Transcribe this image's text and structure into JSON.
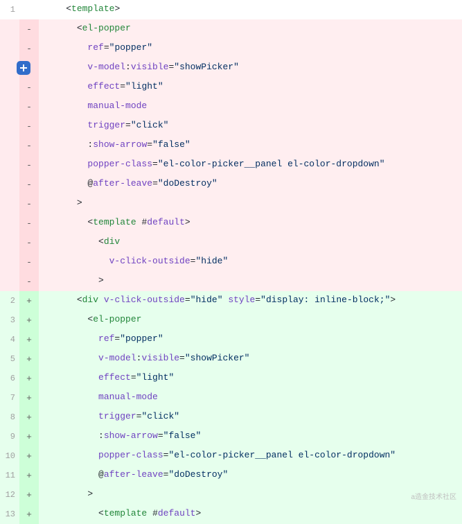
{
  "watermark": "a造金技术社区",
  "lines": [
    {
      "num": "1",
      "type": "context",
      "marker": "",
      "indent": 2,
      "tokens": [
        {
          "t": "punc",
          "v": "<"
        },
        {
          "t": "tag",
          "v": "template"
        },
        {
          "t": "punc",
          "v": ">"
        }
      ]
    },
    {
      "num": "",
      "type": "removed",
      "marker": "-",
      "indent": 3,
      "tokens": [
        {
          "t": "punc",
          "v": "<"
        },
        {
          "t": "tag",
          "v": "el-popper"
        }
      ]
    },
    {
      "num": "",
      "type": "removed",
      "marker": "-",
      "indent": 4,
      "tokens": [
        {
          "t": "attr",
          "v": "ref"
        },
        {
          "t": "punc",
          "v": "="
        },
        {
          "t": "str",
          "v": "\"popper\""
        }
      ]
    },
    {
      "num": "",
      "type": "removed",
      "marker": "-",
      "indent": 4,
      "tokens": [
        {
          "t": "attr",
          "v": "v-model"
        },
        {
          "t": "punc",
          "v": ":"
        },
        {
          "t": "attr",
          "v": "visible"
        },
        {
          "t": "punc",
          "v": "="
        },
        {
          "t": "str",
          "v": "\"showPicker\""
        }
      ]
    },
    {
      "num": "",
      "type": "removed",
      "marker": "-",
      "indent": 4,
      "tokens": [
        {
          "t": "attr",
          "v": "effect"
        },
        {
          "t": "punc",
          "v": "="
        },
        {
          "t": "str",
          "v": "\"light\""
        }
      ]
    },
    {
      "num": "",
      "type": "removed",
      "marker": "-",
      "indent": 4,
      "tokens": [
        {
          "t": "attr",
          "v": "manual-mode"
        }
      ]
    },
    {
      "num": "",
      "type": "removed",
      "marker": "-",
      "indent": 4,
      "tokens": [
        {
          "t": "attr",
          "v": "trigger"
        },
        {
          "t": "punc",
          "v": "="
        },
        {
          "t": "str",
          "v": "\"click\""
        }
      ]
    },
    {
      "num": "",
      "type": "removed",
      "marker": "-",
      "indent": 4,
      "tokens": [
        {
          "t": "punc",
          "v": ":"
        },
        {
          "t": "attr",
          "v": "show-arrow"
        },
        {
          "t": "punc",
          "v": "="
        },
        {
          "t": "str",
          "v": "\"false\""
        }
      ]
    },
    {
      "num": "",
      "type": "removed",
      "marker": "-",
      "indent": 4,
      "tokens": [
        {
          "t": "attr",
          "v": "popper-class"
        },
        {
          "t": "punc",
          "v": "="
        },
        {
          "t": "str",
          "v": "\"el-color-picker__panel el-color-dropdown\""
        }
      ]
    },
    {
      "num": "",
      "type": "removed",
      "marker": "-",
      "indent": 4,
      "tokens": [
        {
          "t": "punc",
          "v": "@"
        },
        {
          "t": "attr",
          "v": "after-leave"
        },
        {
          "t": "punc",
          "v": "="
        },
        {
          "t": "str",
          "v": "\"doDestroy\""
        }
      ]
    },
    {
      "num": "",
      "type": "removed",
      "marker": "-",
      "indent": 3,
      "tokens": [
        {
          "t": "punc",
          "v": ">"
        }
      ]
    },
    {
      "num": "",
      "type": "removed",
      "marker": "-",
      "indent": 4,
      "tokens": [
        {
          "t": "punc",
          "v": "<"
        },
        {
          "t": "tag",
          "v": "template"
        },
        {
          "t": "txt",
          "v": " "
        },
        {
          "t": "punc",
          "v": "#"
        },
        {
          "t": "attr",
          "v": "default"
        },
        {
          "t": "punc",
          "v": ">"
        }
      ]
    },
    {
      "num": "",
      "type": "removed",
      "marker": "-",
      "indent": 5,
      "tokens": [
        {
          "t": "punc",
          "v": "<"
        },
        {
          "t": "tag",
          "v": "div"
        }
      ]
    },
    {
      "num": "",
      "type": "removed",
      "marker": "-",
      "indent": 6,
      "tokens": [
        {
          "t": "attr",
          "v": "v-click-outside"
        },
        {
          "t": "punc",
          "v": "="
        },
        {
          "t": "str",
          "v": "\"hide\""
        }
      ]
    },
    {
      "num": "",
      "type": "removed",
      "marker": "-",
      "indent": 5,
      "tokens": [
        {
          "t": "punc",
          "v": ">"
        }
      ]
    },
    {
      "num": "2",
      "type": "added",
      "marker": "+",
      "indent": 3,
      "tokens": [
        {
          "t": "punc",
          "v": "<"
        },
        {
          "t": "tag",
          "v": "div"
        },
        {
          "t": "txt",
          "v": " "
        },
        {
          "t": "attr",
          "v": "v-click-outside"
        },
        {
          "t": "punc",
          "v": "="
        },
        {
          "t": "str",
          "v": "\"hide\""
        },
        {
          "t": "txt",
          "v": " "
        },
        {
          "t": "attr",
          "v": "style"
        },
        {
          "t": "punc",
          "v": "="
        },
        {
          "t": "str",
          "v": "\"display: inline-block;\""
        },
        {
          "t": "punc",
          "v": ">"
        }
      ]
    },
    {
      "num": "3",
      "type": "added",
      "marker": "+",
      "indent": 4,
      "tokens": [
        {
          "t": "punc",
          "v": "<"
        },
        {
          "t": "tag",
          "v": "el-popper"
        }
      ]
    },
    {
      "num": "4",
      "type": "added",
      "marker": "+",
      "indent": 5,
      "tokens": [
        {
          "t": "attr",
          "v": "ref"
        },
        {
          "t": "punc",
          "v": "="
        },
        {
          "t": "str",
          "v": "\"popper\""
        }
      ]
    },
    {
      "num": "5",
      "type": "added",
      "marker": "+",
      "indent": 5,
      "tokens": [
        {
          "t": "attr",
          "v": "v-model"
        },
        {
          "t": "punc",
          "v": ":"
        },
        {
          "t": "attr",
          "v": "visible"
        },
        {
          "t": "punc",
          "v": "="
        },
        {
          "t": "str",
          "v": "\"showPicker\""
        }
      ]
    },
    {
      "num": "6",
      "type": "added",
      "marker": "+",
      "indent": 5,
      "tokens": [
        {
          "t": "attr",
          "v": "effect"
        },
        {
          "t": "punc",
          "v": "="
        },
        {
          "t": "str",
          "v": "\"light\""
        }
      ]
    },
    {
      "num": "7",
      "type": "added",
      "marker": "+",
      "indent": 5,
      "tokens": [
        {
          "t": "attr",
          "v": "manual-mode"
        }
      ]
    },
    {
      "num": "8",
      "type": "added",
      "marker": "+",
      "indent": 5,
      "tokens": [
        {
          "t": "attr",
          "v": "trigger"
        },
        {
          "t": "punc",
          "v": "="
        },
        {
          "t": "str",
          "v": "\"click\""
        }
      ]
    },
    {
      "num": "9",
      "type": "added",
      "marker": "+",
      "indent": 5,
      "tokens": [
        {
          "t": "punc",
          "v": ":"
        },
        {
          "t": "attr",
          "v": "show-arrow"
        },
        {
          "t": "punc",
          "v": "="
        },
        {
          "t": "str",
          "v": "\"false\""
        }
      ]
    },
    {
      "num": "10",
      "type": "added",
      "marker": "+",
      "indent": 5,
      "tokens": [
        {
          "t": "attr",
          "v": "popper-class"
        },
        {
          "t": "punc",
          "v": "="
        },
        {
          "t": "str",
          "v": "\"el-color-picker__panel el-color-dropdown\""
        }
      ]
    },
    {
      "num": "11",
      "type": "added",
      "marker": "+",
      "indent": 5,
      "tokens": [
        {
          "t": "punc",
          "v": "@"
        },
        {
          "t": "attr",
          "v": "after-leave"
        },
        {
          "t": "punc",
          "v": "="
        },
        {
          "t": "str",
          "v": "\"doDestroy\""
        }
      ]
    },
    {
      "num": "12",
      "type": "added",
      "marker": "+",
      "indent": 4,
      "tokens": [
        {
          "t": "punc",
          "v": ">"
        }
      ]
    },
    {
      "num": "13",
      "type": "added",
      "marker": "+",
      "indent": 5,
      "tokens": [
        {
          "t": "punc",
          "v": "<"
        },
        {
          "t": "tag",
          "v": "template"
        },
        {
          "t": "txt",
          "v": " "
        },
        {
          "t": "punc",
          "v": "#"
        },
        {
          "t": "attr",
          "v": "default"
        },
        {
          "t": "punc",
          "v": ">"
        }
      ]
    }
  ]
}
